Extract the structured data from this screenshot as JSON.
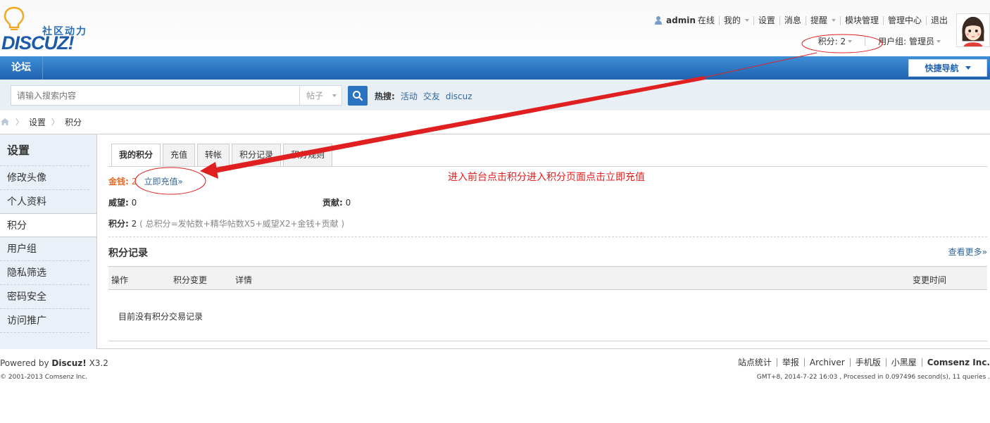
{
  "logo": {
    "cn_text": "社区动力",
    "en_text": "DISCUZ!"
  },
  "usernav": {
    "username": "admin",
    "online": "在线",
    "mine": "我的",
    "settings": "设置",
    "messages": "消息",
    "reminders": "提醒",
    "module_mgmt": "模块管理",
    "admin_center": "管理中心",
    "logout": "退出"
  },
  "subnav": {
    "credits": "积分: 2",
    "usergroup": "用户组: 管理员"
  },
  "nav": {
    "forum": "论坛",
    "quick_nav": "快捷导航"
  },
  "search": {
    "placeholder": "请输入搜索内容",
    "scope": "帖子",
    "hot_label": "热搜:",
    "hot_terms": [
      "活动",
      "交友",
      "discuz"
    ]
  },
  "breadcrumb": [
    "设置",
    "积分"
  ],
  "sidebar": {
    "title": "设置",
    "items": [
      "修改头像",
      "个人资料",
      "积分",
      "用户组",
      "隐私筛选",
      "密码安全",
      "访问推广"
    ]
  },
  "tabs": [
    "我的积分",
    "充值",
    "转帐",
    "积分记录",
    "积分规则"
  ],
  "credits": {
    "money_label": "金钱:",
    "money_value": "2",
    "recharge_link": "立即充值»",
    "prestige_label": "威望:",
    "prestige_value": "0",
    "contribution_label": "贡献:",
    "contribution_value": "0",
    "total_label": "积分:",
    "total_value": "2",
    "formula": "( 总积分=发帖数+精华帖数X5+威望X2+金钱+贡献 )"
  },
  "log": {
    "title": "积分记录",
    "more": "查看更多»",
    "columns": [
      "操作",
      "积分变更",
      "详情",
      "变更时间"
    ],
    "empty": "目前没有积分交易记录"
  },
  "annotation": {
    "note": "进入前台点击积分进入积分页面点击立即充值",
    "color": "#e02020"
  },
  "footer": {
    "powered_prefix": "Powered by",
    "powered_brand": "Discuz!",
    "version": "X3.2",
    "copyright": "© 2001-2013 Comsenz Inc.",
    "links": [
      "站点统计",
      "举报",
      "Archiver",
      "手机版",
      "小黑屋",
      "Comsenz Inc."
    ],
    "info": "GMT+8, 2014-7-22 16:03 , Processed in 0.097496 second(s), 11 queries ."
  },
  "colors": {
    "nav_blue": "#1f62b0",
    "link": "#336699",
    "money": "#e46a24"
  }
}
